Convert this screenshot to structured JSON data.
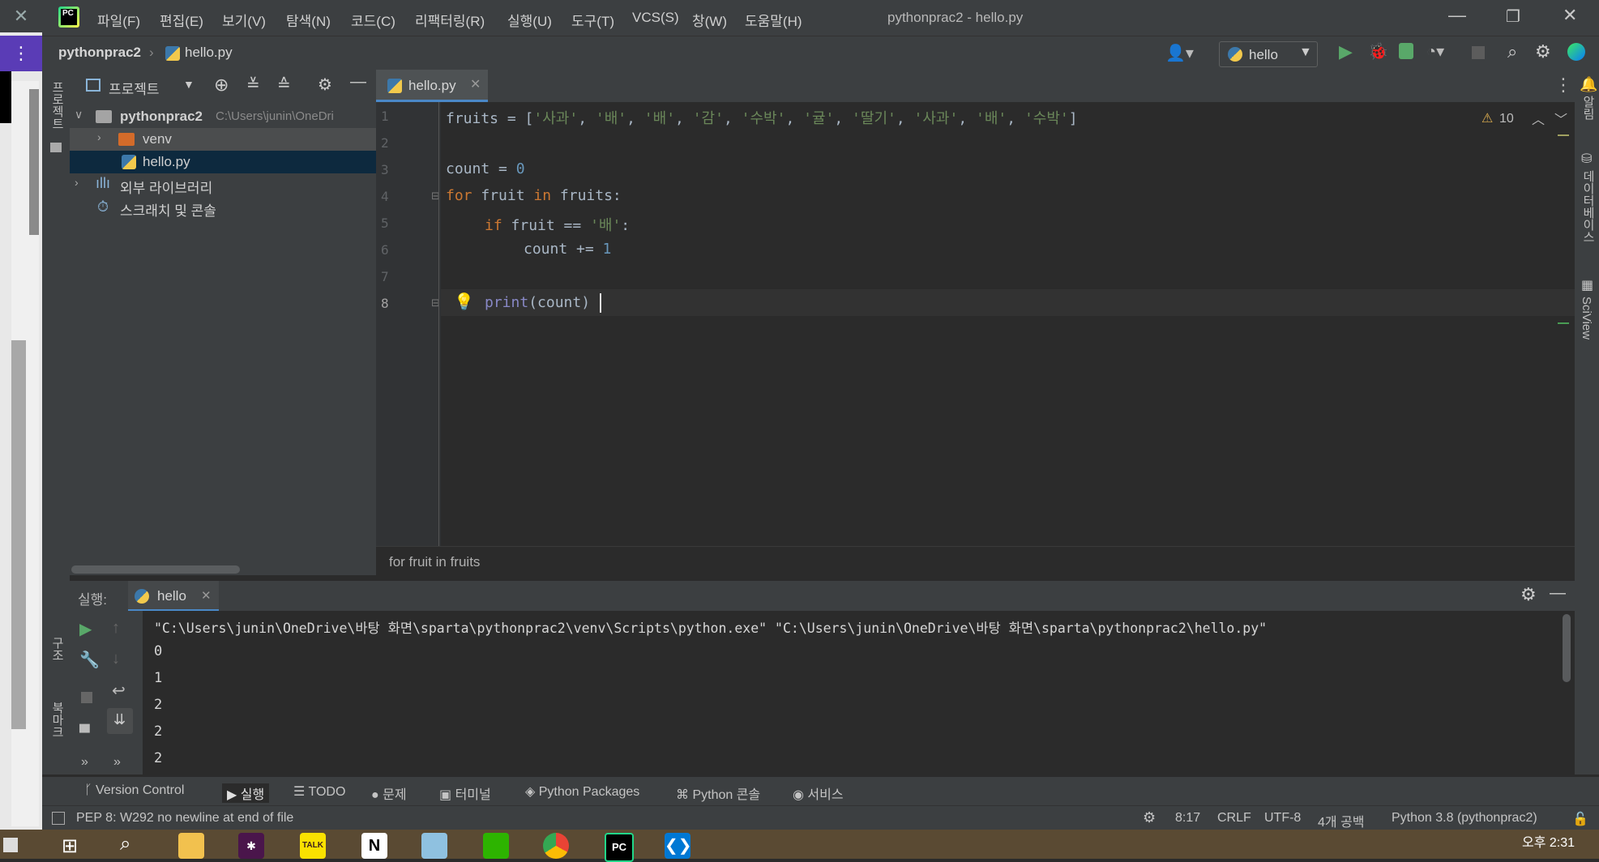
{
  "menu": [
    "파일(F)",
    "편집(E)",
    "보기(V)",
    "탐색(N)",
    "코드(C)",
    "리팩터링(R)",
    "실행(U)",
    "도구(T)",
    "VCS(S)",
    "창(W)",
    "도움말(H)"
  ],
  "window_title": "pythonprac2 - hello.py",
  "breadcrumb": {
    "project": "pythonprac2",
    "file": "hello.py"
  },
  "run_config": "hello",
  "side_labels": {
    "project": "프로젝트",
    "structure": "구조",
    "bookmarks": "북마크",
    "notifications": "알림",
    "database": "데이터베이스",
    "sciview": "SciView"
  },
  "project_panel": {
    "title": "프로젝트",
    "tree": [
      {
        "label": "pythonprac2",
        "path": "C:\\Users\\junin\\OneDri",
        "icon": "folder-icon"
      },
      {
        "label": "venv",
        "icon": "folder-icon"
      },
      {
        "label": "hello.py",
        "icon": "python-file-icon"
      },
      {
        "label": "외부 라이브러리",
        "icon": "library-icon"
      },
      {
        "label": "스크래치 및 콘솔",
        "icon": "scratch-icon"
      }
    ]
  },
  "editor": {
    "tab": "hello.py",
    "warnings": "10",
    "line_numbers": [
      "1",
      "2",
      "3",
      "4",
      "5",
      "6",
      "7",
      "8"
    ],
    "code": {
      "l1_var": "fruits",
      "l1_op": " = [",
      "l1_items": [
        "'사과'",
        "'배'",
        "'배'",
        "'감'",
        "'수박'",
        "'귤'",
        "'딸기'",
        "'사과'",
        "'배'",
        "'수박'"
      ],
      "l1_end": "]",
      "l3_var": "count = ",
      "l3_num": "0",
      "l4_kw1": "for",
      "l4_mid": " fruit ",
      "l4_kw2": "in",
      "l4_end": " fruits:",
      "l5_kw": "if",
      "l5_mid": " fruit == ",
      "l5_str": "'배'",
      "l5_end": ":",
      "l6_var": "count += ",
      "l6_num": "1",
      "l8_fn": "print",
      "l8_rest": "(count)"
    },
    "breadcrumb": "for fruit in fruits"
  },
  "run_panel": {
    "label": "실행:",
    "tab": "hello",
    "command": "\"C:\\Users\\junin\\OneDrive\\바탕 화면\\sparta\\pythonprac2\\venv\\Scripts\\python.exe\" \"C:\\Users\\junin\\OneDrive\\바탕 화면\\sparta\\pythonprac2\\hello.py\"",
    "output": [
      "0",
      "1",
      "2",
      "2",
      "2"
    ]
  },
  "tool_windows": [
    "Version Control",
    "실행",
    "TODO",
    "문제",
    "터미널",
    "Python Packages",
    "Python 콘솔",
    "서비스"
  ],
  "status": {
    "message": "PEP 8: W292 no newline at end of file",
    "position": "8:17",
    "line_sep": "CRLF",
    "encoding": "UTF-8",
    "indent": "4개 공백",
    "interpreter": "Python 3.8 (pythonprac2)"
  },
  "taskbar": {
    "time": "오후 2:31",
    "kakao_label": "TALK",
    "pycharm_label": "PC",
    "notion_label": "N"
  },
  "colors": {
    "keyword": "#cc7832",
    "string": "#6a8759",
    "number": "#6897bb",
    "builtin": "#8888c6",
    "selection": "#0d293e",
    "accent": "#4a88c7"
  }
}
